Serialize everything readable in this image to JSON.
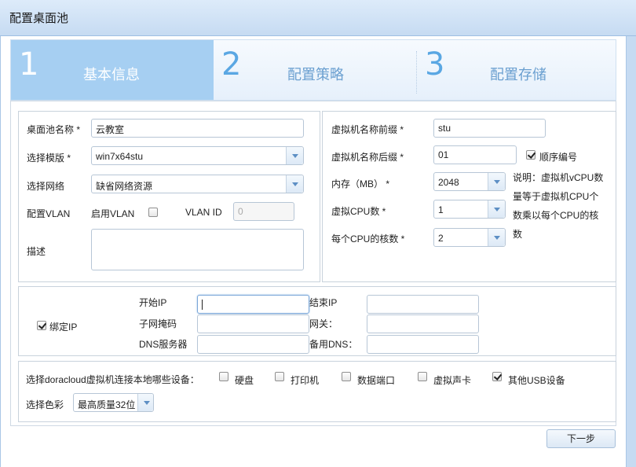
{
  "window": {
    "title": "配置桌面池"
  },
  "steps": [
    {
      "num": "1",
      "label": "基本信息",
      "active": true
    },
    {
      "num": "2",
      "label": "配置策略",
      "active": false
    },
    {
      "num": "3",
      "label": "配置存储",
      "active": false
    }
  ],
  "basic": {
    "pool_name_label": "桌面池名称 *",
    "pool_name_value": "云教室",
    "template_label": "选择模版 *",
    "template_value": "win7x64stu",
    "network_label": "选择网络",
    "network_value": "缺省网络资源",
    "vlan_label": "配置VLAN",
    "vlan_enable_label": "启用VLAN",
    "vlan_enable_checked": false,
    "vlan_id_label": "VLAN ID",
    "vlan_id_placeholder": "0",
    "desc_label": "描述",
    "desc_value": ""
  },
  "vm": {
    "prefix_label": "虚拟机名称前缀 *",
    "prefix_value": "stu",
    "suffix_label": "虚拟机名称后缀 *",
    "suffix_value": "01",
    "seq_label": "顺序编号",
    "seq_checked": true,
    "memory_label": "内存（MB） *",
    "memory_value": "2048",
    "cpu_label": "虚拟CPU数 *",
    "cpu_value": "1",
    "cores_label": "每个CPU的核数 *",
    "cores_value": "2",
    "note": "说明：虚拟机vCPU数量等于虚拟机CPU个数乘以每个CPU的核数"
  },
  "ip": {
    "bind_label": "绑定IP",
    "bind_checked": true,
    "start_ip_label": "开始IP",
    "start_ip_value": "",
    "end_ip_label": "结束IP",
    "end_ip_value": "",
    "mask_label": "子网掩码",
    "mask_value": "",
    "gateway_label": "网关：",
    "gateway_value": "",
    "dns_label": "DNS服务器",
    "dns_value": "",
    "dns2_label": "备用DNS：",
    "dns2_value": ""
  },
  "devices": {
    "prompt": "选择doracloud虚拟机连接本地哪些设备：",
    "items": [
      {
        "label": "硬盘",
        "checked": false
      },
      {
        "label": "打印机",
        "checked": false
      },
      {
        "label": "数据端口",
        "checked": false
      },
      {
        "label": "虚拟声卡",
        "checked": false
      },
      {
        "label": "其他USB设备",
        "checked": true
      }
    ],
    "color_label": "选择色彩",
    "color_value": "最高质量32位"
  },
  "footer": {
    "next_label": "下一步"
  }
}
